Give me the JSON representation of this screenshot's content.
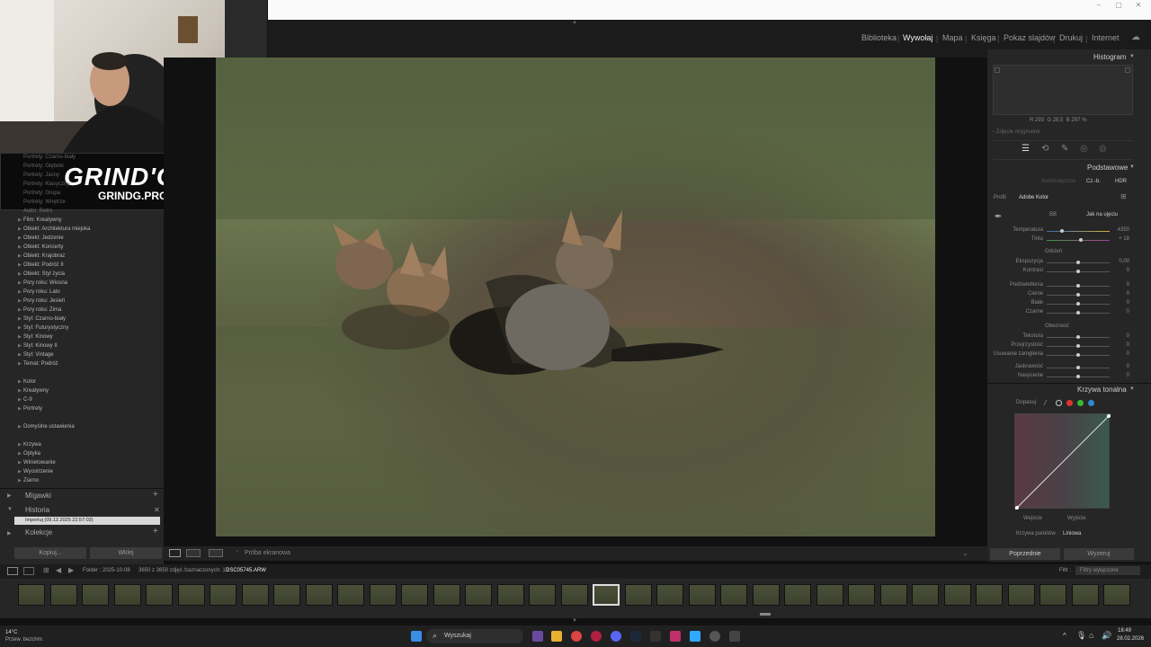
{
  "modules": [
    "Biblioteka",
    "Wywołaj",
    "Mapa",
    "Księga",
    "Pokaz slajdów",
    "Drukuj",
    "Internet"
  ],
  "overlay": {
    "logo_title": "GRIND'G",
    "logo_sub": "GRINDG.PRO"
  },
  "presets_hidden": [
    "Portrety: Czarno-biały",
    "Portrety: Głęboki",
    "Portrety: Jasny",
    "Portrety: Klasyczny",
    "Portrety: Grupa",
    "Portrety: Wnętrze",
    "Autor: Retro"
  ],
  "presets": [
    "Film: Kreatywny",
    "Obiekt: Architektura miejska",
    "Obiekt: Jedzenie",
    "Obiekt: Koncerty",
    "Obiekt: Krajobraz",
    "Obiekt: Podróż II",
    "Obiekt: Styl życia",
    "Pory roku: Wiosna",
    "Pory roku: Lato",
    "Pory roku: Jesień",
    "Pory roku: Zima",
    "Styl: Czarno-biały",
    "Styl: Futurystyczny",
    "Styl: Kinowy",
    "Styl: Kinowy II",
    "Styl: Vintage",
    "Temat: Podróż"
  ],
  "user_presets": [
    "Kolor",
    "Kreatywny",
    "C-9",
    "Portrety"
  ],
  "defaults": "Domyślne ustawienia",
  "extra_presets": [
    "Krzywa",
    "Optyka",
    "Winietowanie",
    "Wyostrzenie",
    "Ziarno"
  ],
  "panels": {
    "snapshots": "Migawki",
    "history": "Historia",
    "history_item": "Importuj (09.12.2025 22:57:03)",
    "collections": "Kolekcje"
  },
  "left_buttons": {
    "copy": "Kopiuj...",
    "paste": "Wklej"
  },
  "toolbar": {
    "proof": "Próba ekranowa"
  },
  "histogram": {
    "title": "Histogram",
    "r": "293",
    "g": "28,5",
    "b": "297",
    "original": "Zdjęcie oryginalne"
  },
  "basic": {
    "title": "Podstawowe",
    "auto": "Automatyczne",
    "treatment": "Cz.-b.",
    "hdr": "HDR",
    "profile_label": "Profil",
    "profile_value": "Adobe Kolor",
    "wb_label": "BB",
    "wb_value": "Jak na ujęciu",
    "sliders": [
      {
        "label": "Temperatura",
        "value": "4350"
      },
      {
        "label": "Tinta",
        "value": "+ 18"
      },
      {
        "label": "Ekspozycja",
        "value": "0,00"
      },
      {
        "label": "Kontrast",
        "value": "0"
      },
      {
        "label": "Podświetlenia",
        "value": "0"
      },
      {
        "label": "Cienie",
        "value": "0"
      },
      {
        "label": "Białe",
        "value": "0"
      },
      {
        "label": "Czarne",
        "value": "0"
      },
      {
        "label": "Tekstura",
        "value": "0"
      },
      {
        "label": "Przejrzystość",
        "value": "0"
      },
      {
        "label": "Usuwanie zamglenia",
        "value": "0"
      },
      {
        "label": "Jaskrawość",
        "value": "0"
      },
      {
        "label": "Nasycenie",
        "value": "0"
      }
    ],
    "tone_header": "Odcień",
    "presence_header": "Obecność"
  },
  "curve": {
    "title": "Krzywa tonalna",
    "adjust": "Dopasuj",
    "input": "Wejście",
    "output": "Wyjście",
    "points_label": "Krzywa punktów",
    "points_value": "Liniowa"
  },
  "right_buttons": {
    "previous": "Poprzednie",
    "reset": "Wyzeruj"
  },
  "filmbar": {
    "folder": "Folder : 2025-10-08",
    "count": "3650 z 3650 zdjęć /zaznaczonych: 1 /",
    "file": "DSC05745.ARW",
    "filter_label": "Filtr :",
    "filter_value": "Filtry wyłączone"
  },
  "taskbar": {
    "weather_temp": "14°C",
    "weather_desc": "Przew. bezchm.",
    "search": "Wyszukaj",
    "time": "18:49",
    "date": "28.02.2026"
  }
}
